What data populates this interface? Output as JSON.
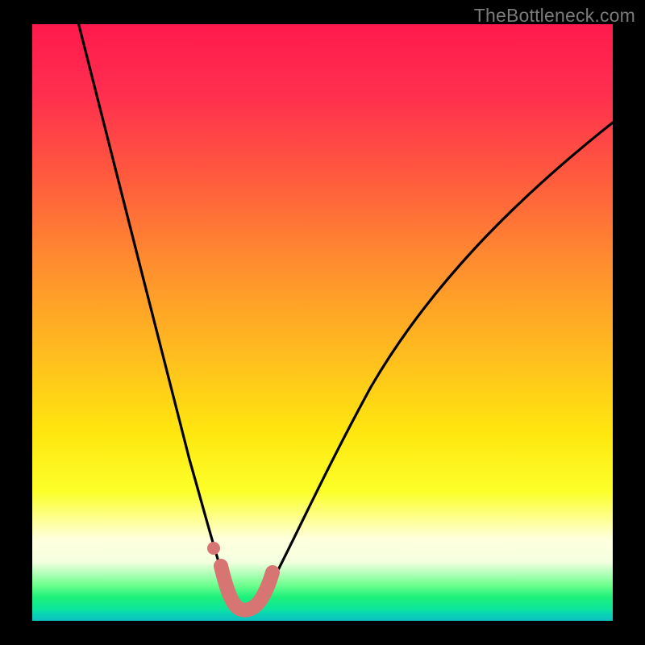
{
  "watermark": "TheBottleneck.com",
  "chart_data": {
    "type": "line",
    "title": "",
    "xlabel": "",
    "ylabel": "",
    "xlim": [
      0,
      100
    ],
    "ylim": [
      0,
      100
    ],
    "grid": false,
    "note": "Axes unlabeled; values estimated from curve position against plot-area pixel coordinates (0-100 normalized).",
    "series": [
      {
        "name": "bottleneck-curve",
        "color": "#000000",
        "x": [
          8,
          12,
          16,
          20,
          24,
          28,
          30,
          32,
          34,
          35,
          36,
          37,
          38,
          40,
          42,
          46,
          52,
          60,
          70,
          82,
          96,
          100
        ],
        "y": [
          100,
          82,
          65,
          49,
          34,
          20,
          14,
          9,
          5,
          3,
          2,
          2,
          3,
          6,
          11,
          21,
          34,
          48,
          60,
          71,
          81,
          84
        ]
      },
      {
        "name": "highlight-segment",
        "color": "#d77572",
        "x": [
          32.5,
          33.5,
          34.5,
          35.5,
          36.5,
          37.5,
          38.5,
          39.5,
          40.5
        ],
        "y": [
          8.5,
          5.0,
          3.0,
          2.0,
          2.0,
          2.2,
          3.0,
          5.0,
          8.0
        ]
      },
      {
        "name": "highlight-dot",
        "color": "#d77572",
        "x": [
          31.2
        ],
        "y": [
          12.0
        ]
      }
    ],
    "background_gradient": {
      "top": "#ff1a4d",
      "mid": "#ffe70f",
      "bottom": "#0bbfc0"
    }
  }
}
